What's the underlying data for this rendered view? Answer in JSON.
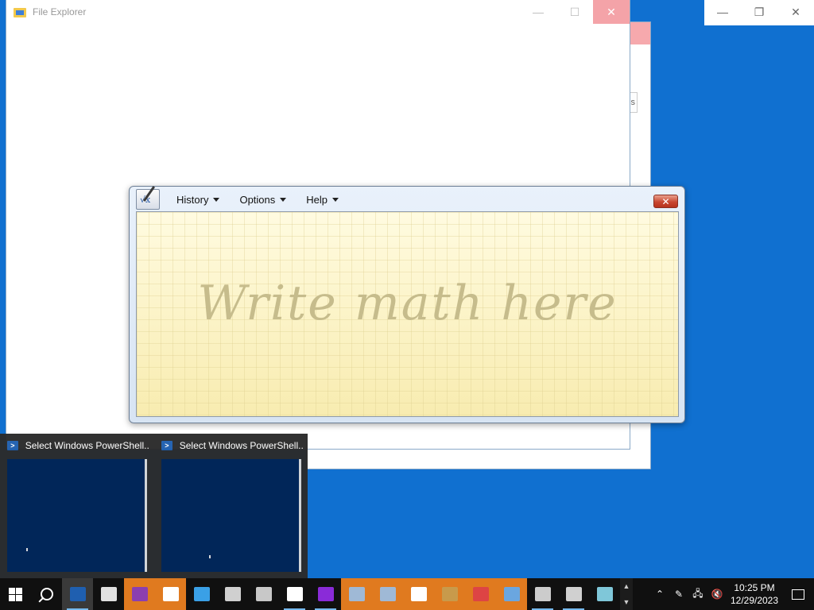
{
  "file_explorer": {
    "title": "File Explorer",
    "minimize_glyph": "—",
    "maximize_glyph": "☐",
    "close_glyph": "✕"
  },
  "back_window": {
    "partial_button_text": "ess"
  },
  "top_right_window": {
    "minimize_glyph": "—",
    "restore_glyph": "❐",
    "close_glyph": "✕"
  },
  "math_panel": {
    "menus": [
      {
        "label": "History"
      },
      {
        "label": "Options"
      },
      {
        "label": "Help"
      }
    ],
    "close_glyph": "✕",
    "app_icon_text": "√x",
    "hint_text": "Write math here"
  },
  "thumbnails": [
    {
      "title": "Select Windows PowerShell..."
    },
    {
      "title": "Select Windows PowerShell..."
    }
  ],
  "taskbar": {
    "apps": [
      {
        "name": "powershell-icon",
        "color": "#1f5fb0"
      },
      {
        "name": "paint-icon",
        "color": "#e0e0e0"
      },
      {
        "name": "winrar-icon",
        "color": "#8b3fb0"
      },
      {
        "name": "xbox-icon",
        "color": "#ffffff"
      },
      {
        "name": "phone-icon",
        "color": "#3aa0e6"
      },
      {
        "name": "shapes-icon",
        "color": "#d0d0d0"
      },
      {
        "name": "image-viewer-icon",
        "color": "#c8c8c8"
      },
      {
        "name": "camera-icon",
        "color": "#ffffff"
      },
      {
        "name": "mixed-reality-icon",
        "color": "#8a2bd8"
      },
      {
        "name": "window-app-icon-1",
        "color": "#9fb9d6"
      },
      {
        "name": "window-app-icon-2",
        "color": "#9fb9d6"
      },
      {
        "name": "settings-gear-icon",
        "color": "#ffffff"
      },
      {
        "name": "package-icon",
        "color": "#c89a4b"
      },
      {
        "name": "compass-icon",
        "color": "#d44"
      },
      {
        "name": "snipping-icon",
        "color": "#6aa6e0"
      },
      {
        "name": "terminal-icon",
        "color": "#cccccc"
      },
      {
        "name": "remote-desktop-icon",
        "color": "#d0d0d0"
      },
      {
        "name": "notes-icon",
        "color": "#7fc7d9"
      }
    ],
    "time": "10:25 PM",
    "date": "12/29/2023"
  }
}
